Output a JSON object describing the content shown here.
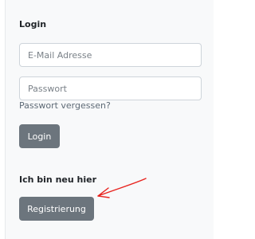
{
  "login": {
    "heading": "Login",
    "email_placeholder": "E-Mail Adresse",
    "password_placeholder": "Passwort",
    "forgot_link": "Passwort vergessen?",
    "submit_label": "Login"
  },
  "register": {
    "heading": "Ich bin neu hier",
    "button_label": "Registrierung"
  },
  "annotation": {
    "icon": "red-arrow-icon",
    "color": "#e8231e"
  },
  "colors": {
    "button": "#6c757d",
    "panel": "#f8f9fa"
  }
}
